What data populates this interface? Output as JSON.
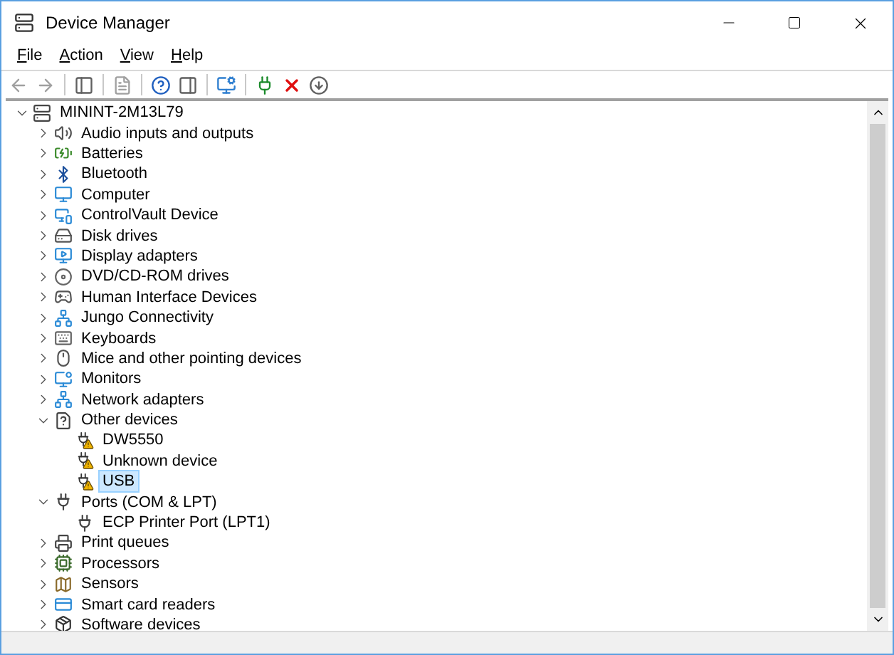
{
  "window": {
    "title": "Device Manager"
  },
  "menu": [
    {
      "label": "File"
    },
    {
      "label": "Action"
    },
    {
      "label": "View"
    },
    {
      "label": "Help"
    }
  ],
  "toolbar": [
    {
      "kind": "back",
      "disabled": true
    },
    {
      "kind": "forward",
      "disabled": true
    },
    {
      "kind": "sep"
    },
    {
      "kind": "console",
      "disabled": false
    },
    {
      "kind": "sep"
    },
    {
      "kind": "properties",
      "disabled": true
    },
    {
      "kind": "sep"
    },
    {
      "kind": "help",
      "disabled": false
    },
    {
      "kind": "view",
      "disabled": false
    },
    {
      "kind": "sep"
    },
    {
      "kind": "scan",
      "disabled": false
    },
    {
      "kind": "sep"
    },
    {
      "kind": "add-driver",
      "disabled": false
    },
    {
      "kind": "uninstall",
      "disabled": false
    },
    {
      "kind": "download",
      "disabled": false
    }
  ],
  "tree": {
    "label": "MININT-2M13L79",
    "expanded": true,
    "selected": false,
    "children": [
      {
        "label": "Audio inputs and outputs",
        "expanded": false,
        "selected": false
      },
      {
        "label": "Batteries",
        "expanded": false,
        "selected": false
      },
      {
        "label": "Bluetooth",
        "expanded": false,
        "selected": false
      },
      {
        "label": "Computer",
        "expanded": false,
        "selected": false
      },
      {
        "label": "ControlVault Device",
        "expanded": false,
        "selected": false
      },
      {
        "label": "Disk drives",
        "expanded": false,
        "selected": false
      },
      {
        "label": "Display adapters",
        "expanded": false,
        "selected": false
      },
      {
        "label": "DVD/CD-ROM drives",
        "expanded": false,
        "selected": false
      },
      {
        "label": "Human Interface Devices",
        "expanded": false,
        "selected": false
      },
      {
        "label": "Jungo Connectivity",
        "expanded": false,
        "selected": false
      },
      {
        "label": "Keyboards",
        "expanded": false,
        "selected": false
      },
      {
        "label": "Mice and other pointing devices",
        "expanded": false,
        "selected": false
      },
      {
        "label": "Monitors",
        "expanded": false,
        "selected": false
      },
      {
        "label": "Network adapters",
        "expanded": false,
        "selected": false
      },
      {
        "label": "Other devices",
        "expanded": true,
        "selected": false,
        "children": [
          {
            "label": "DW5550",
            "selected": false,
            "warning": true
          },
          {
            "label": "Unknown device",
            "selected": false,
            "warning": true
          },
          {
            "label": "USB",
            "selected": true,
            "warning": true
          }
        ]
      },
      {
        "label": "Ports (COM & LPT)",
        "expanded": true,
        "selected": false,
        "children": [
          {
            "label": "ECP Printer Port (LPT1)",
            "selected": false,
            "warning": false
          }
        ]
      },
      {
        "label": "Print queues",
        "expanded": false,
        "selected": false
      },
      {
        "label": "Processors",
        "expanded": false,
        "selected": false
      },
      {
        "label": "Sensors",
        "expanded": false,
        "selected": false
      },
      {
        "label": "Smart card readers",
        "expanded": false,
        "selected": false
      },
      {
        "label": "Software devices",
        "expanded": false,
        "selected": false
      }
    ]
  }
}
